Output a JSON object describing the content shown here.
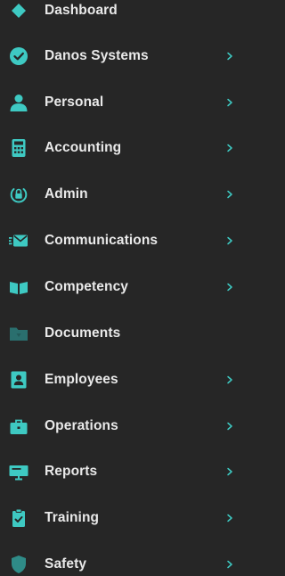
{
  "sidebar": {
    "accent_color": "#3ec9c2",
    "items": [
      {
        "label": "Dashboard",
        "icon": "diamond-icon",
        "has_submenu": false
      },
      {
        "label": "Danos Systems",
        "icon": "check-circle-icon",
        "has_submenu": true
      },
      {
        "label": "Personal",
        "icon": "person-icon",
        "has_submenu": true
      },
      {
        "label": "Accounting",
        "icon": "calculator-icon",
        "has_submenu": true
      },
      {
        "label": "Admin",
        "icon": "lock-icon",
        "has_submenu": true
      },
      {
        "label": "Communications",
        "icon": "envelope-icon",
        "has_submenu": true
      },
      {
        "label": "Competency",
        "icon": "book-icon",
        "has_submenu": true
      },
      {
        "label": "Documents",
        "icon": "folder-icon",
        "has_submenu": false
      },
      {
        "label": "Employees",
        "icon": "id-badge-icon",
        "has_submenu": true
      },
      {
        "label": "Operations",
        "icon": "briefcase-icon",
        "has_submenu": true
      },
      {
        "label": "Reports",
        "icon": "presentation-board-icon",
        "has_submenu": true
      },
      {
        "label": "Training",
        "icon": "clipboard-check-icon",
        "has_submenu": true
      },
      {
        "label": "Safety",
        "icon": "shield-icon",
        "has_submenu": true
      }
    ]
  }
}
